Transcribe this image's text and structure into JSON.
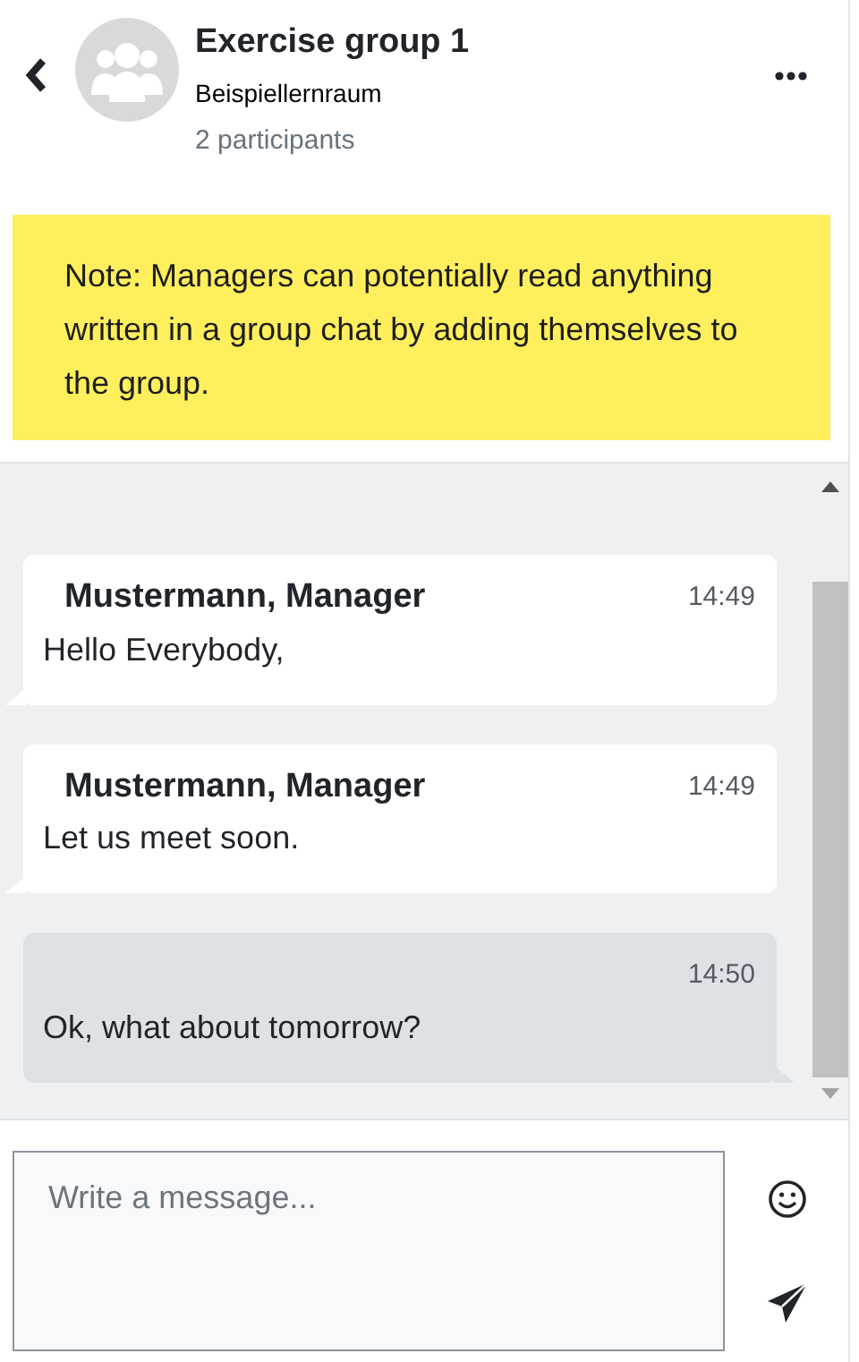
{
  "header": {
    "title": "Exercise group 1",
    "subtitle": "Beispiellernraum",
    "participants": "2 participants"
  },
  "note": "Note: Managers can potentially read anything written in a group chat by adding themselves to the group.",
  "messages": [
    {
      "kind": "received",
      "author": "Mustermann, Manager",
      "time": "14:49",
      "text": "Hello Everybody,"
    },
    {
      "kind": "received",
      "author": "Mustermann, Manager",
      "time": "14:49",
      "text": "Let us meet soon."
    },
    {
      "kind": "sent",
      "time": "14:50",
      "text": "Ok, what about tomorrow?"
    }
  ],
  "composer": {
    "placeholder": "Write a message..."
  }
}
